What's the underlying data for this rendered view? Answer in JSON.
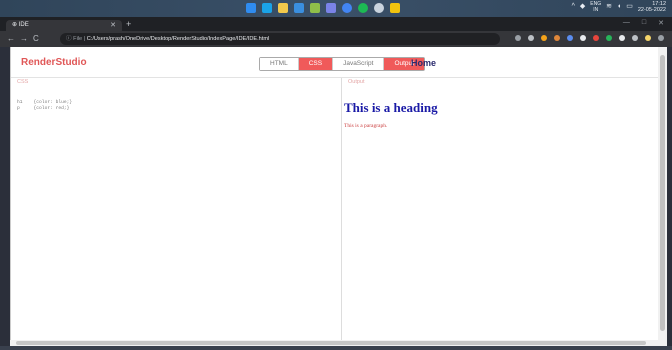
{
  "taskbar": {
    "icons": [
      {
        "name": "windows-start-icon",
        "color": "#2f8cf0"
      },
      {
        "name": "search-icon",
        "color": "#1aa3e8"
      },
      {
        "name": "file-explorer-icon",
        "color": "#f2c94c"
      },
      {
        "name": "mail-icon",
        "color": "#3a8fe0"
      },
      {
        "name": "paint-icon",
        "color": "#8fbf4a"
      },
      {
        "name": "chat-icon",
        "color": "#7a83e8"
      },
      {
        "name": "chrome-icon",
        "color": "#4285f4"
      },
      {
        "name": "spotify-icon",
        "color": "#1db954"
      },
      {
        "name": "settings-icon",
        "color": "#c9d3de"
      },
      {
        "name": "sticky-notes-icon",
        "color": "#f1c40f"
      }
    ],
    "tray": {
      "lang_top": "ENG",
      "lang_bottom": "IN",
      "time": "17:12",
      "date": "22-05-2022"
    }
  },
  "browser": {
    "tab_title": "IDE",
    "address_scheme": "File",
    "address_url": "C:/Users/prash/OneDrive/Desktop/RenderStudio/IndexPage/IDE/IDE.html"
  },
  "app": {
    "brand": "RenderStudio",
    "toggles": [
      {
        "label": "HTML",
        "active": false
      },
      {
        "label": "CSS",
        "active": true
      },
      {
        "label": "JavaScript",
        "active": false
      },
      {
        "label": "Output",
        "active": true
      }
    ],
    "home_label": "Home",
    "css_panel_label": "CSS",
    "css_code": [
      "h1    {color: blue;}",
      "p     {color: red;}"
    ],
    "output_panel_label": "Output",
    "output_heading": "This is a heading",
    "output_paragraph": "This is a paragraph."
  },
  "colors": {
    "accent": "#f05a5a",
    "brand": "#e05757",
    "heading": "#1a1aa6",
    "paragraph": "#cc4444"
  }
}
